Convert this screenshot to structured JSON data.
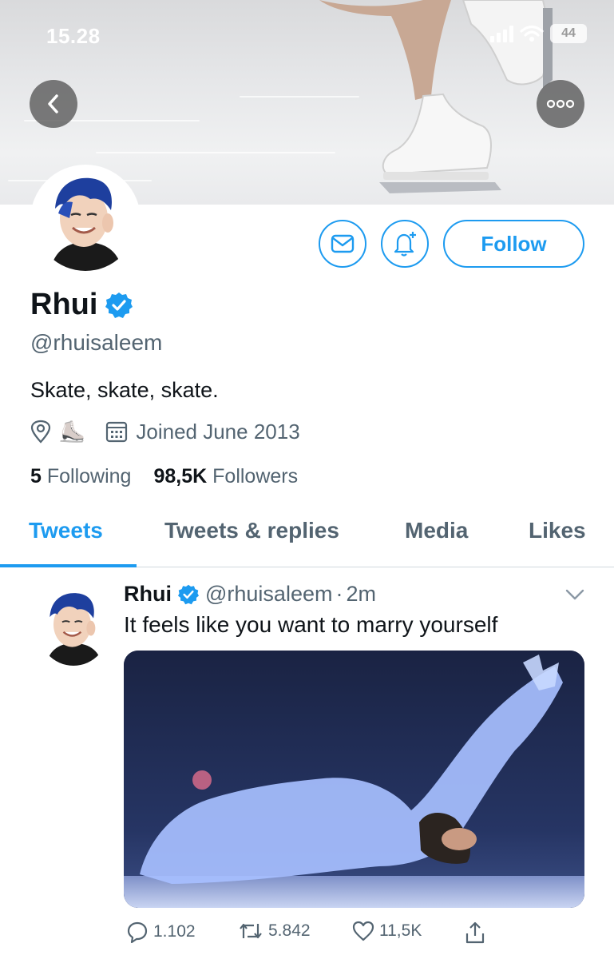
{
  "status_bar": {
    "time": "15.28",
    "battery": "44"
  },
  "profile": {
    "display_name": "Rhui",
    "handle": "@rhuisaleem",
    "bio": "Skate, skate, skate.",
    "location_emoji": "⛸️",
    "joined": "Joined June 2013",
    "following_count": "5",
    "following_label": "Following",
    "followers_count": "98,5K",
    "followers_label": "Followers",
    "follow_button": "Follow"
  },
  "tabs": [
    {
      "label": "Tweets",
      "active": true
    },
    {
      "label": "Tweets & replies",
      "active": false
    },
    {
      "label": "Media",
      "active": false
    },
    {
      "label": "Likes",
      "active": false
    }
  ],
  "tweet": {
    "name": "Rhui",
    "handle": "@rhuisaleem",
    "separator": "·",
    "time": "2m",
    "text": "It feels like you want to marry yourself",
    "replies": "1.102",
    "retweets": "5.842",
    "likes": "11,5K"
  },
  "colors": {
    "accent": "#1d9bf0",
    "secondary_text": "#536471",
    "verified": "#1d9bf0"
  }
}
